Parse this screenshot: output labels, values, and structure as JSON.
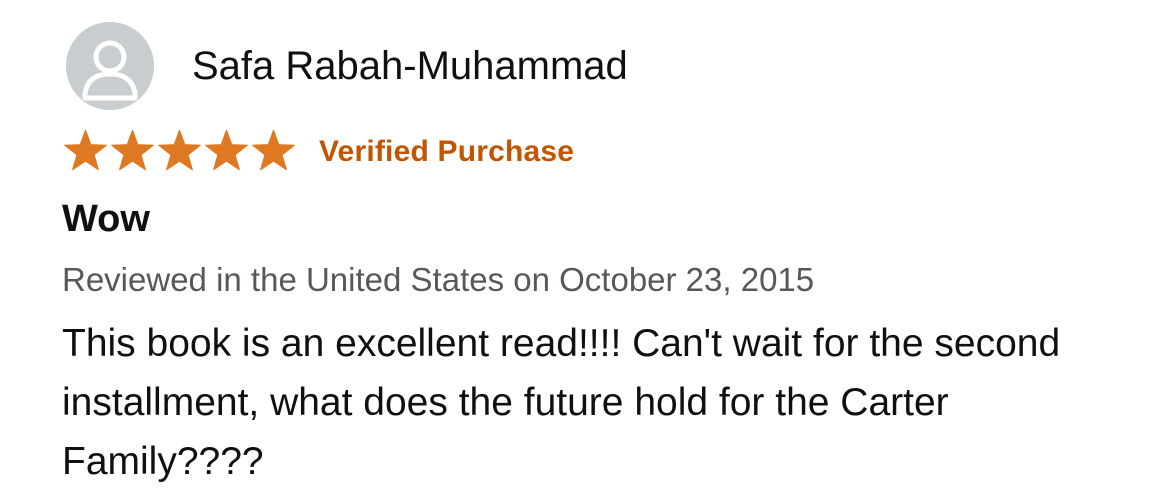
{
  "review": {
    "profile": {
      "name": "Safa Rabah-Muhammad",
      "avatar_icon": "default-user-avatar-icon"
    },
    "rating": {
      "stars": 5,
      "max": 5,
      "star_color": "#de7921",
      "verified_label": "Verified Purchase",
      "verified_color": "#c45500"
    },
    "title": "Wow",
    "meta": "Reviewed in the United States on October 23, 2015",
    "body": "This book is an excellent read!!!! Can't wait for the second installment, what does the future hold for the Carter Family????"
  }
}
